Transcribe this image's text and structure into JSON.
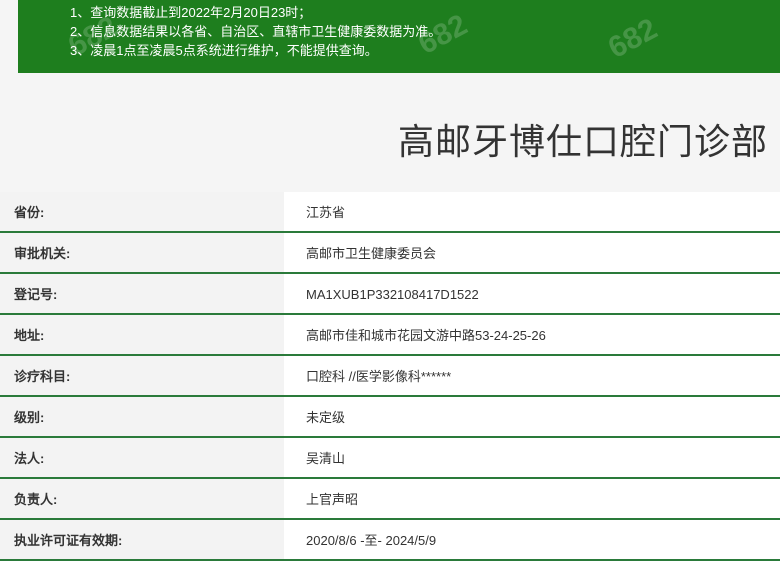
{
  "notice": {
    "lines": [
      "1、查询数据截止到2022年2月20日23时；",
      "2、信息数据结果以各省、自治区、直辖市卫生健康委数据为准。",
      "3、凌晨1点至凌晨5点系统进行维护，不能提供查询。"
    ],
    "background": "#1e7e1e",
    "watermark": "682"
  },
  "page_title": "高邮牙博仕口腔门诊部",
  "details": [
    {
      "label": "省份:",
      "value": "江苏省"
    },
    {
      "label": "审批机关:",
      "value": "高邮市卫生健康委员会"
    },
    {
      "label": "登记号:",
      "value": "MA1XUB1P332108417D1522"
    },
    {
      "label": "地址:",
      "value": "高邮市佳和城市花园文游中路53-24-25-26"
    },
    {
      "label": "诊疗科目:",
      "value": "口腔科 //医学影像科******"
    },
    {
      "label": "级别:",
      "value": "未定级"
    },
    {
      "label": "法人:",
      "value": "吴清山"
    },
    {
      "label": "负责人:",
      "value": "上官声昭"
    },
    {
      "label": "执业许可证有效期:",
      "value": "2020/8/6 -至- 2024/5/9"
    }
  ],
  "colors": {
    "accent_green": "#1e7e1e",
    "row_border": "#2a7a3a"
  }
}
